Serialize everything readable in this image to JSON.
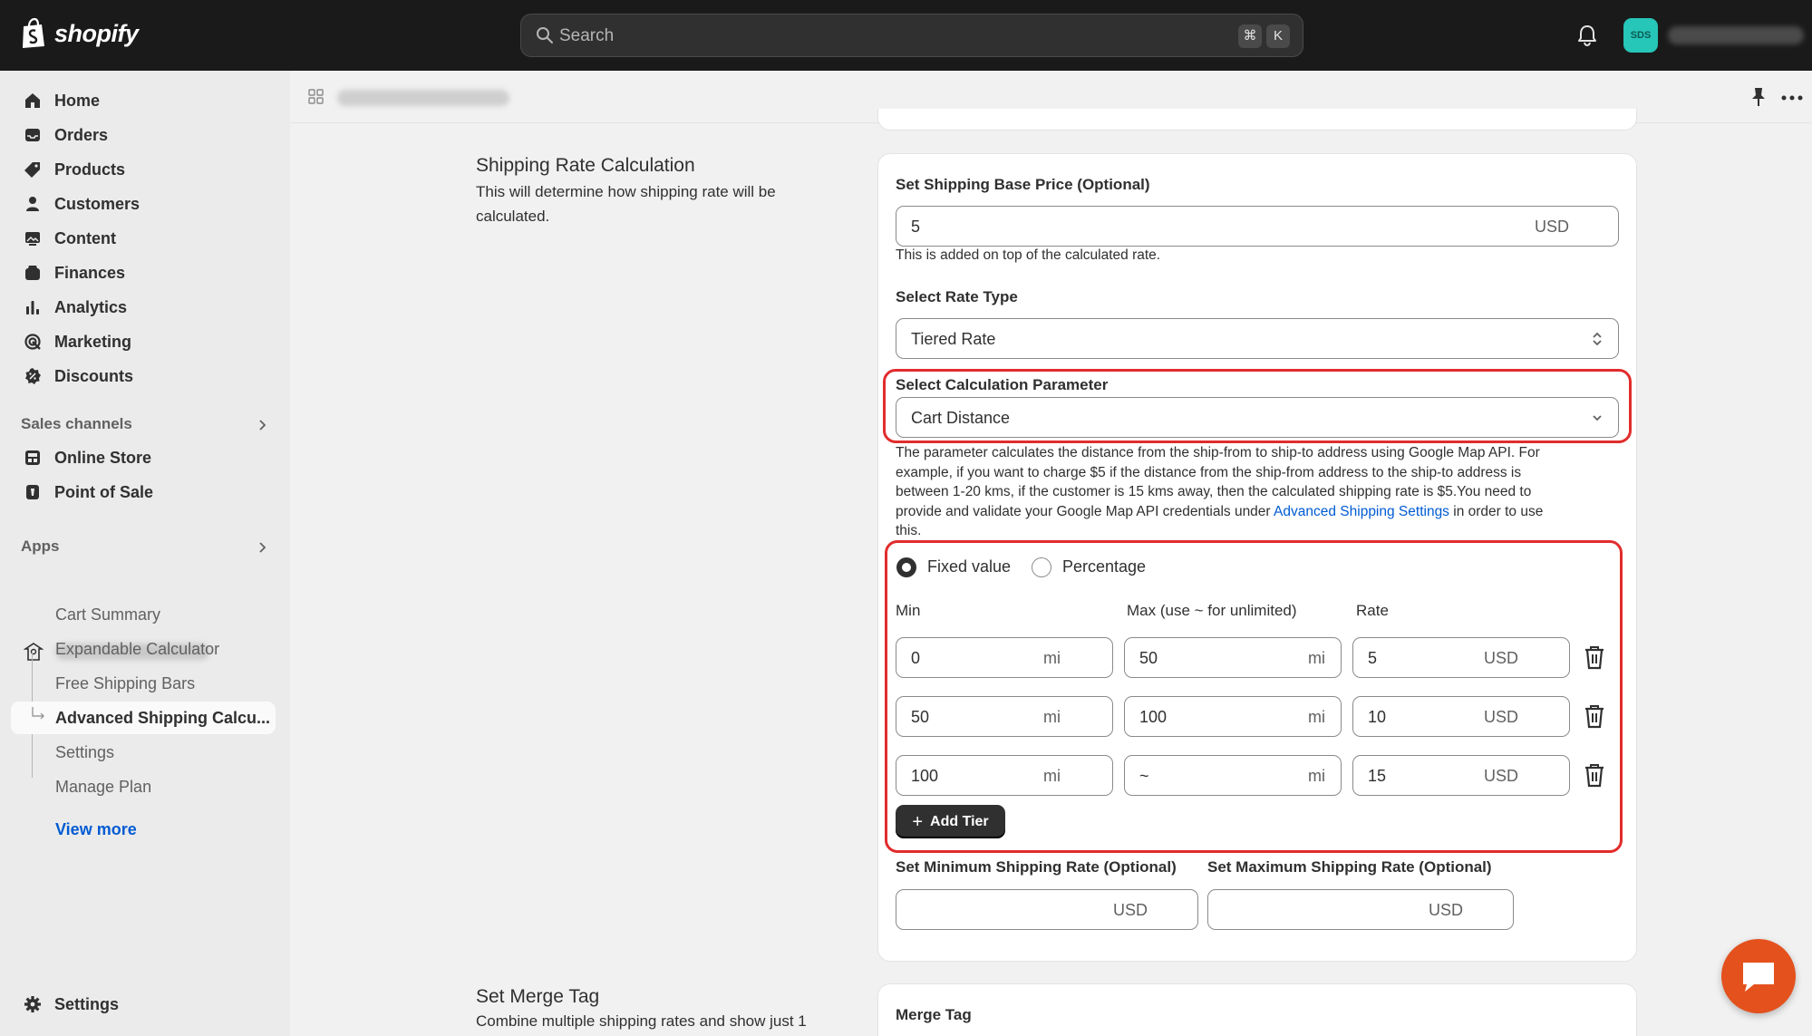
{
  "topbar": {
    "logo_text": "shopify",
    "search_placeholder": "Search",
    "shortcut_cmd": "⌘",
    "shortcut_key": "K",
    "avatar_initials": "SDS"
  },
  "sidebar": {
    "nav": [
      {
        "label": "Home",
        "icon": "home-icon"
      },
      {
        "label": "Orders",
        "icon": "inbox-icon"
      },
      {
        "label": "Products",
        "icon": "tag-icon"
      },
      {
        "label": "Customers",
        "icon": "person-icon"
      },
      {
        "label": "Content",
        "icon": "image-icon"
      },
      {
        "label": "Finances",
        "icon": "bank-icon"
      },
      {
        "label": "Analytics",
        "icon": "bar-chart-icon"
      },
      {
        "label": "Marketing",
        "icon": "target-icon"
      },
      {
        "label": "Discounts",
        "icon": "discount-icon"
      }
    ],
    "sales_channels_heading": "Sales channels",
    "sales_channels": [
      {
        "label": "Online Store",
        "icon": "store-icon"
      },
      {
        "label": "Point of Sale",
        "icon": "pos-icon"
      }
    ],
    "apps_heading": "Apps",
    "app_items": [
      {
        "label": "Cart Summary"
      },
      {
        "label": "Expandable Calculator"
      },
      {
        "label": "Free Shipping Bars"
      },
      {
        "label": "Advanced Shipping Calcu..."
      },
      {
        "label": "Settings"
      },
      {
        "label": "Manage Plan"
      }
    ],
    "view_more": "View more",
    "settings": "Settings"
  },
  "section1": {
    "title": "Shipping Rate Calculation",
    "description": "This will determine how shipping rate will be calculated."
  },
  "form": {
    "base_price_label": "Set Shipping Base Price (Optional)",
    "base_price_value": "5",
    "currency": "USD",
    "base_price_help": "This is added on top of the calculated rate.",
    "rate_type_label": "Select Rate Type",
    "rate_type_value": "Tiered Rate",
    "calc_param_label": "Select Calculation Parameter",
    "calc_param_value": "Cart Distance",
    "calc_help_lines": [
      "The parameter calculates the distance from the ship-from to ship-to address using Google Map API. For",
      "example, if you want to charge $5 if the distance from the ship-from address to the ship-to address is",
      "between 1-20 kms, if the customer is 15 kms away, then the calculated shipping rate is $5.You need to"
    ],
    "calc_help_line4_pre": "provide and validate your Google Map API credentials under ",
    "calc_help_link": "Advanced Shipping Settings",
    "calc_help_line4_post": " in order to use",
    "calc_help_line5": "this.",
    "value_type_options": [
      {
        "label": "Fixed value",
        "selected": true
      },
      {
        "label": "Percentage",
        "selected": false
      }
    ],
    "col_min": "Min",
    "col_max": "Max (use ~ for unlimited)",
    "col_rate": "Rate",
    "unit": "mi",
    "tiers": [
      {
        "min": "0",
        "max": "50",
        "rate": "5"
      },
      {
        "min": "50",
        "max": "100",
        "rate": "10"
      },
      {
        "min": "100",
        "max": "~",
        "rate": "15"
      }
    ],
    "add_tier_label": "Add Tier",
    "min_rate_label": "Set Minimum Shipping Rate (Optional)",
    "max_rate_label": "Set Maximum Shipping Rate (Optional)"
  },
  "section2": {
    "title": "Set Merge Tag",
    "description": "Combine multiple shipping rates and show just 1",
    "card_label": "Merge Tag"
  },
  "colors": {
    "accent": "#005bd3",
    "highlight": "#e22c2c",
    "chat": "#e4511d",
    "avatar": "#26c6b8"
  }
}
